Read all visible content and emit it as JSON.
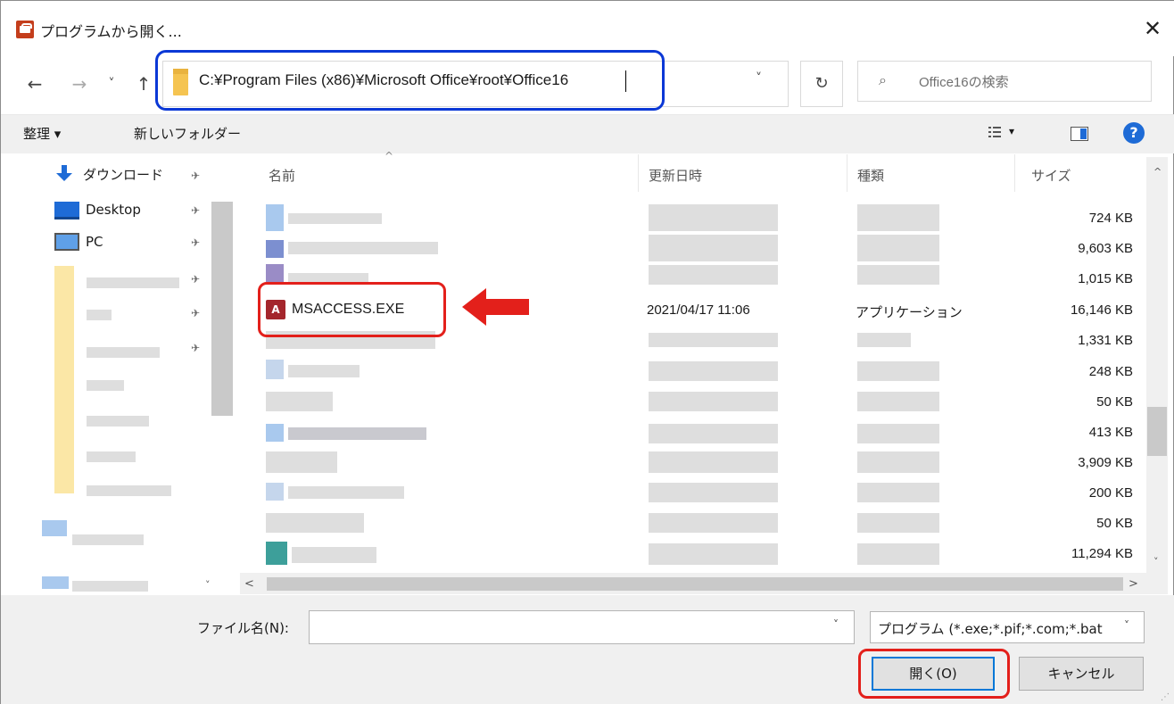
{
  "window": {
    "title": "プログラムから開く...",
    "close_label": "✕"
  },
  "nav": {
    "back": "←",
    "forward": "→",
    "history": "˅",
    "up": "↑",
    "address": "C:¥Program Files (x86)¥Microsoft Office¥root¥Office16",
    "address_dropdown": "˅",
    "refresh": "↻",
    "search_icon": "⌕",
    "search_placeholder": "Office16の検索"
  },
  "toolbar": {
    "organize_label": "整理 ▾",
    "new_folder_label": "新しいフォルダー",
    "view_dropdown": "▾",
    "help": "?"
  },
  "left_pane": {
    "items": [
      {
        "label": "ダウンロード",
        "icon": "download-arrow-icon"
      },
      {
        "label": "Desktop",
        "icon": "desktop-icon"
      },
      {
        "label": "PC",
        "icon": "pc-icon"
      }
    ],
    "pin": "📌",
    "up_arrow": "^",
    "down_arrow": "˅"
  },
  "columns": {
    "name": "名前",
    "modified": "更新日時",
    "type": "種類",
    "size": "サイズ"
  },
  "files": {
    "sizes": [
      "724 KB",
      "9,603 KB",
      "1,015 KB",
      "16,146 KB",
      "1,331 KB",
      "248 KB",
      "50 KB",
      "413 KB",
      "3,909 KB",
      "200 KB",
      "50 KB",
      "11,294 KB"
    ],
    "highlighted": {
      "name": "MSACCESS.EXE",
      "icon_text": "A",
      "date": "2021/04/17 11:06",
      "type": "アプリケーション",
      "size": "16,146 KB"
    }
  },
  "scroll": {
    "left": "<",
    "right": ">",
    "up": "^",
    "down": "˅"
  },
  "bottom": {
    "filename_label": "ファイル名(N):",
    "filename_value": "",
    "filename_dropdown": "˅",
    "filter_label": "プログラム (*.exe;*.pif;*.com;*.bat",
    "filter_dropdown": "˅",
    "open_button": "開く(O)",
    "cancel_button": "キャンセル"
  },
  "colors": {
    "highlight_blue": "#0b38d6",
    "highlight_red": "#e3201b",
    "access_red": "#a4262c"
  }
}
